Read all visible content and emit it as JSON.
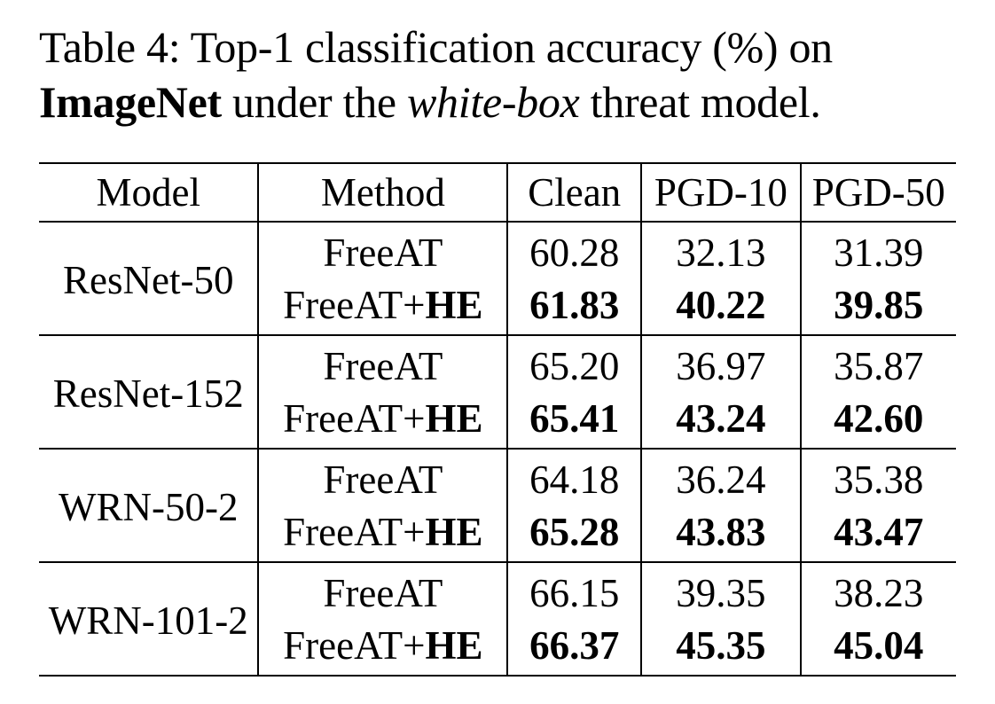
{
  "caption": {
    "prefix": "Table 4:  Top-1 classification accuracy (%) on",
    "dataset": "ImageNet",
    "middle": " under the ",
    "threat": "white-box",
    "suffix": " threat model."
  },
  "table": {
    "headers": [
      "Model",
      "Method",
      "Clean",
      "PGD-10",
      "PGD-50"
    ],
    "groups": [
      {
        "model": "ResNet-50",
        "rows": [
          {
            "method": "FreeAT",
            "method_bold": "",
            "clean": "60.28",
            "pgd10": "32.13",
            "pgd50": "31.39"
          },
          {
            "method": "FreeAT+",
            "method_bold": "HE",
            "clean": "61.83",
            "pgd10": "40.22",
            "pgd50": "39.85"
          }
        ]
      },
      {
        "model": "ResNet-152",
        "rows": [
          {
            "method": "FreeAT",
            "method_bold": "",
            "clean": "65.20",
            "pgd10": "36.97",
            "pgd50": "35.87"
          },
          {
            "method": "FreeAT+",
            "method_bold": "HE",
            "clean": "65.41",
            "pgd10": "43.24",
            "pgd50": "42.60"
          }
        ]
      },
      {
        "model": "WRN-50-2",
        "rows": [
          {
            "method": "FreeAT",
            "method_bold": "",
            "clean": "64.18",
            "pgd10": "36.24",
            "pgd50": "35.38"
          },
          {
            "method": "FreeAT+",
            "method_bold": "HE",
            "clean": "65.28",
            "pgd10": "43.83",
            "pgd50": "43.47"
          }
        ]
      },
      {
        "model": "WRN-101-2",
        "rows": [
          {
            "method": "FreeAT",
            "method_bold": "",
            "clean": "66.15",
            "pgd10": "39.35",
            "pgd50": "38.23"
          },
          {
            "method": "FreeAT+",
            "method_bold": "HE",
            "clean": "66.37",
            "pgd10": "45.35",
            "pgd50": "45.04"
          }
        ]
      }
    ]
  }
}
